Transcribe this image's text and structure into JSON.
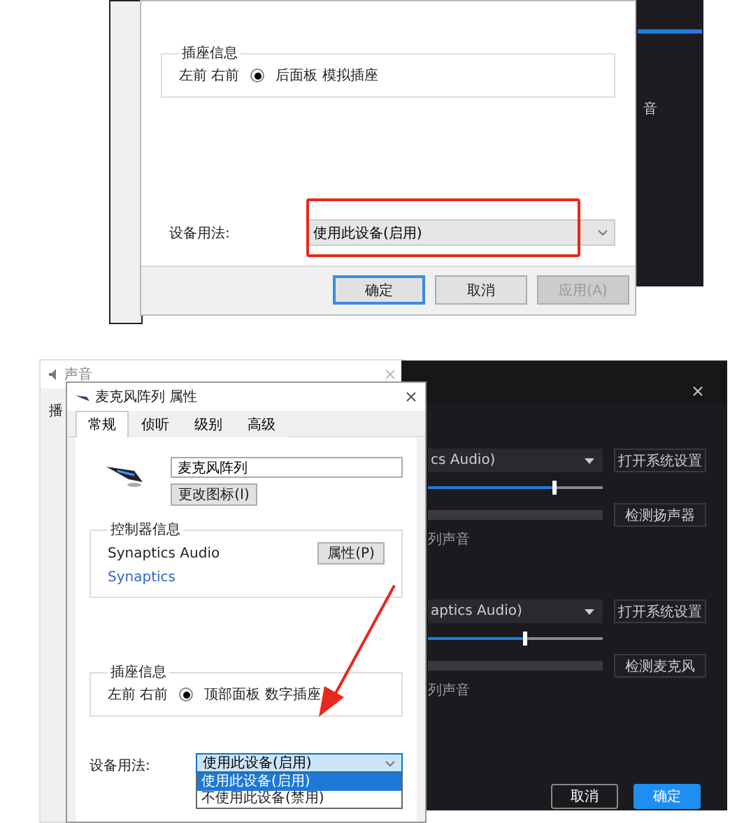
{
  "top_screenshot": {
    "jack_info": {
      "title": "插座信息",
      "channels": "左前 右前",
      "radio_selected": true,
      "jack": "后面板 模拟插座"
    },
    "device_usage": {
      "label": "设备用法:",
      "value": "使用此设备(启用)",
      "highlighted": true
    },
    "buttons": [
      {
        "label": "确定",
        "default": true,
        "disabled": false
      },
      {
        "label": "取消",
        "default": false,
        "disabled": false
      },
      {
        "label": "应用(A)",
        "default": false,
        "disabled": true
      }
    ],
    "background_app_text": "音"
  },
  "bottom_screenshot": {
    "sound_window": {
      "title": "声音",
      "tab_fragment": "播"
    },
    "properties_dialog": {
      "title": "麦克风阵列 属性",
      "tabs": [
        {
          "label": "常规",
          "selected": true
        },
        {
          "label": "侦听",
          "selected": false
        },
        {
          "label": "级别",
          "selected": false
        },
        {
          "label": "高级",
          "selected": false
        }
      ],
      "name_value": "麦克风阵列",
      "change_icon_button": "更改图标(I)",
      "controller_info": {
        "title": "控制器信息",
        "name": "Synaptics Audio",
        "properties_button": "属性(P)",
        "vendor_link": "Synaptics"
      },
      "jack_info": {
        "title": "插座信息",
        "channels": "左前 右前",
        "radio_selected": true,
        "jack": "顶部面板 数字插座"
      },
      "device_usage": {
        "label": "设备用法:",
        "value": "使用此设备(启用)",
        "options": [
          {
            "label": "使用此设备(启用)",
            "selected": true
          },
          {
            "label": "不使用此设备(禁用)",
            "selected": false
          }
        ]
      }
    },
    "audio_settings": {
      "sections": [
        {
          "device": "cs Audio)",
          "system_button": "打开系统设置",
          "level": 0.72,
          "test_button": "检测扬声器",
          "note": "列声音"
        },
        {
          "device": "aptics Audio)",
          "system_button": "打开系统设置",
          "level": 0.55,
          "test_button": "检测麦克风",
          "note": "列声音"
        }
      ],
      "buttons": [
        {
          "label": "取消",
          "primary": false
        },
        {
          "label": "确定",
          "primary": true
        }
      ]
    }
  }
}
